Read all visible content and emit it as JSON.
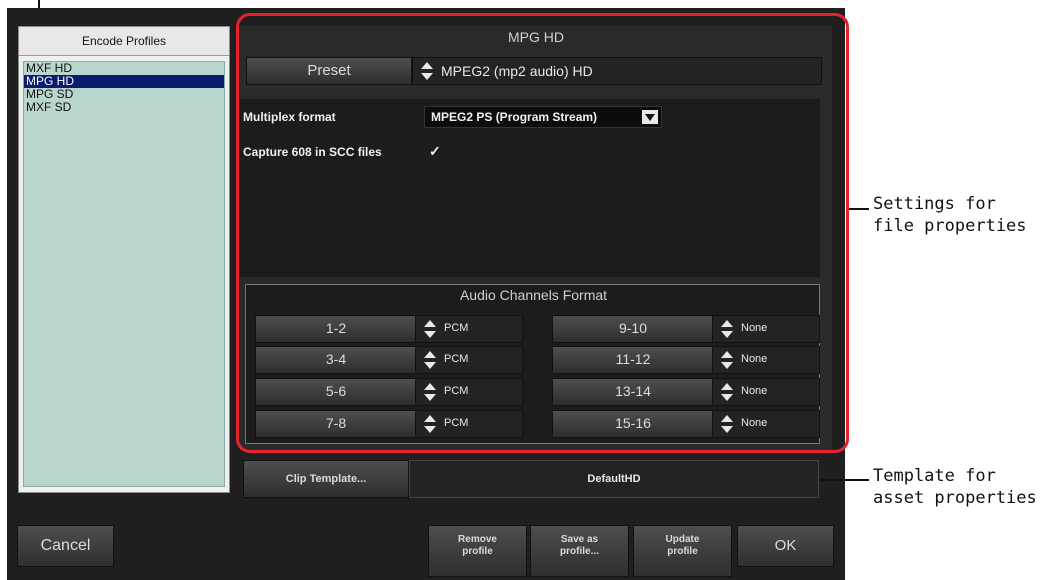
{
  "profiles": {
    "header": "Encode Profiles",
    "items": [
      {
        "label": "MXF HD",
        "selected": false
      },
      {
        "label": "MPG HD",
        "selected": true
      },
      {
        "label": "MPG SD",
        "selected": false
      },
      {
        "label": "MXF SD",
        "selected": false
      }
    ]
  },
  "settings": {
    "title": "MPG HD",
    "preset_label": "Preset",
    "preset_value": "MPEG2 (mp2 audio) HD",
    "multiplex_label": "Multiplex format",
    "multiplex_value": "MPEG2 PS (Program Stream)",
    "capture_label": "Capture 608 in SCC files",
    "capture_checked": true,
    "capture_mark": "✓"
  },
  "audio": {
    "title": "Audio Channels Format",
    "channels": [
      {
        "label": "1-2",
        "value": "PCM"
      },
      {
        "label": "3-4",
        "value": "PCM"
      },
      {
        "label": "5-6",
        "value": "PCM"
      },
      {
        "label": "7-8",
        "value": "PCM"
      },
      {
        "label": "9-10",
        "value": "None"
      },
      {
        "label": "11-12",
        "value": "None"
      },
      {
        "label": "13-14",
        "value": "None"
      },
      {
        "label": "15-16",
        "value": "None"
      }
    ]
  },
  "template": {
    "button_label": "Clip Template...",
    "value": "DefaultHD"
  },
  "buttons": {
    "cancel": "Cancel",
    "remove_line1": "Remove",
    "remove_line2": "profile",
    "save_line1": "Save as",
    "save_line2": "profile...",
    "update_line1": "Update",
    "update_line2": "profile",
    "ok": "OK"
  },
  "callouts": {
    "file_line1": "Settings for",
    "file_line2": "file properties",
    "asset_line1": "Template for",
    "asset_line2": "asset properties"
  },
  "colors": {
    "highlight": "#e8202a",
    "selected_profile": "#0a1c6e",
    "profile_list_bg": "#b8d6cc"
  }
}
